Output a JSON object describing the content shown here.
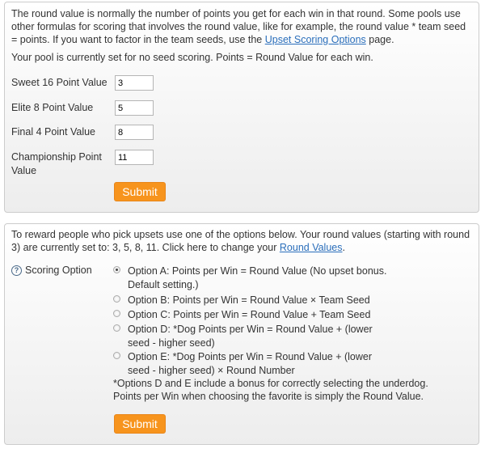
{
  "round_values_panel": {
    "intro_before_link": "The round value is normally the number of points you get for each win in that round. Some pools use other formulas for scoring that involves the round value, like for example, the round value * team seed = points. If you want to factor in the team seeds, use the ",
    "intro_link": "Upset Scoring Options",
    "intro_after_link": " page.",
    "current_setting": "Your pool is currently set for no seed scoring. Points = Round Value for each win.",
    "fields": [
      {
        "label": "Sweet 16 Point Value",
        "value": "3"
      },
      {
        "label": "Elite 8 Point Value",
        "value": "5"
      },
      {
        "label": "Final 4 Point Value",
        "value": "8"
      },
      {
        "label": "Championship Point Value",
        "value": "11"
      }
    ],
    "submit_label": "Submit"
  },
  "upset_panel": {
    "intro_before_link": "To reward people who pick upsets use one of the options below. Your round values (starting with round 3) are currently set to: 3, 5, 8, 11. Click here to change your ",
    "intro_link": "Round Values",
    "intro_after_link": ".",
    "help_icon": "?",
    "scoring_label": "Scoring Option",
    "options": [
      {
        "label": "Option A: Points per Win = Round Value (No upset bonus. Default setting.)",
        "checked": true
      },
      {
        "label": "Option B: Points per Win = Round Value × Team Seed",
        "checked": false
      },
      {
        "label": "Option C: Points per Win = Round Value + Team Seed",
        "checked": false
      },
      {
        "label": "Option D: *Dog Points per Win = Round Value + (lower seed - higher seed)",
        "checked": false
      },
      {
        "label": "Option E: *Dog Points per Win = Round Value + (lower seed - higher seed) × Round Number",
        "checked": false
      }
    ],
    "footnote_line1": "*Options D and E include a bonus for correctly selecting the underdog.",
    "footnote_line2": "Points per Win when choosing the favorite is simply the Round Value.",
    "submit_label": "Submit"
  },
  "colors": {
    "accent": "#f7941d",
    "link": "#2a6ebb"
  }
}
